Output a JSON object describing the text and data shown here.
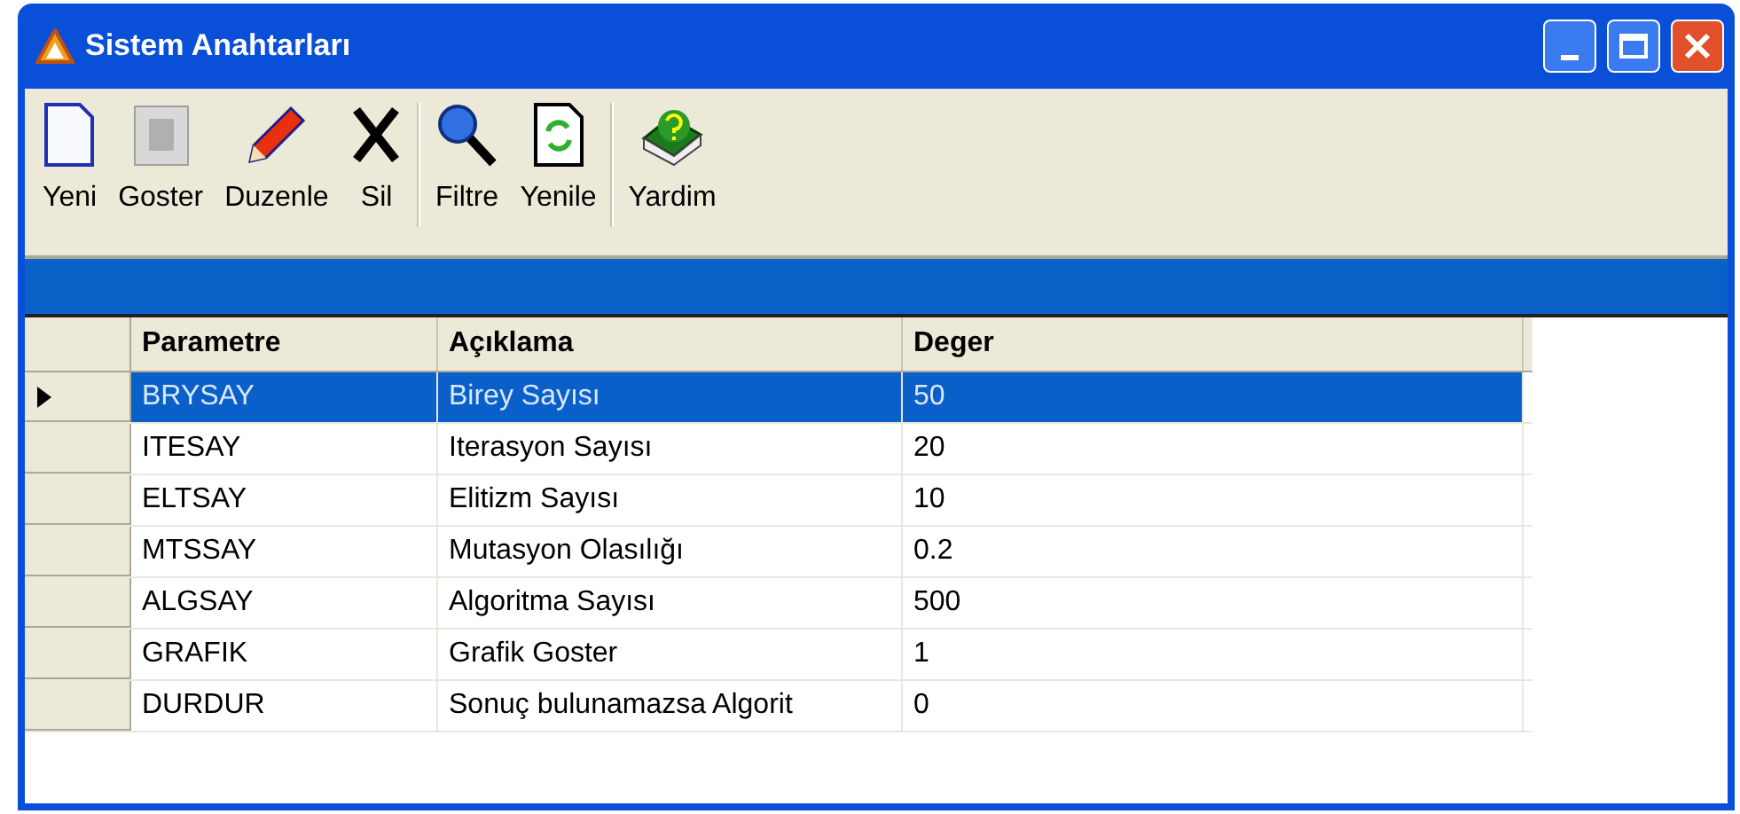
{
  "window": {
    "title": "Sistem Anahtarları"
  },
  "toolbar": [
    {
      "label": "Yeni",
      "kind": "new"
    },
    {
      "label": "Goster",
      "kind": "show"
    },
    {
      "label": "Duzenle",
      "kind": "edit"
    },
    {
      "label": "Sil",
      "kind": "delete"
    },
    {
      "label": "Filtre",
      "kind": "filter"
    },
    {
      "label": "Yenile",
      "kind": "refresh"
    },
    {
      "label": "Yardim",
      "kind": "help"
    }
  ],
  "table": {
    "columns": [
      "Parametre",
      "Açıklama",
      "Deger"
    ],
    "rows": [
      {
        "cells": [
          "BRYSAY",
          "Birey Sayısı",
          "50"
        ],
        "selected": true
      },
      {
        "cells": [
          "ITESAY",
          "Iterasyon Sayısı",
          "20"
        ],
        "selected": false
      },
      {
        "cells": [
          "ELTSAY",
          "Elitizm Sayısı",
          "10"
        ],
        "selected": false
      },
      {
        "cells": [
          "MTSSAY",
          "Mutasyon Olasılığı",
          "0.2"
        ],
        "selected": false
      },
      {
        "cells": [
          "ALGSAY",
          "Algoritma Sayısı",
          "500"
        ],
        "selected": false
      },
      {
        "cells": [
          "GRAFIK",
          "Grafik Goster",
          "1"
        ],
        "selected": false
      },
      {
        "cells": [
          "DURDUR",
          "Sonuç bulunamazsa Algorit",
          "0"
        ],
        "selected": false
      }
    ]
  }
}
